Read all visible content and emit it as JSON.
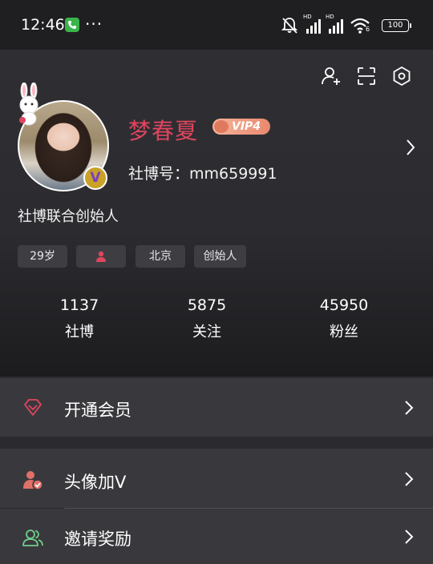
{
  "status_bar": {
    "time": "12:46",
    "dots": "···",
    "battery": "100",
    "signal_1_label": "HD",
    "signal_2_label": "HD",
    "wifi_label": "6"
  },
  "profile": {
    "nickname": "梦春夏",
    "vip_level": "VIP4",
    "uid_label": "社博号：",
    "uid": "mm659991",
    "uid_full": "社博号：mm659991",
    "bio": "社博联合创始人",
    "avatar_badge": "V",
    "tags": [
      "29岁",
      "",
      "北京",
      "创始人"
    ],
    "gender_icon": "person-icon",
    "stats": [
      {
        "value": "1137",
        "label": "社博"
      },
      {
        "value": "5875",
        "label": "关注"
      },
      {
        "value": "45950",
        "label": "粉丝"
      }
    ]
  },
  "menu": {
    "membership": {
      "label": "开通会员",
      "icon": "diamond-icon"
    },
    "avatar_v": {
      "label": "头像加V",
      "icon": "user-verified-icon"
    },
    "invite": {
      "label": "邀请奖励",
      "icon": "users-icon"
    }
  },
  "colors": {
    "accent_pink": "#e0455f",
    "background": "#2b2b2f",
    "row": "#39393d"
  }
}
